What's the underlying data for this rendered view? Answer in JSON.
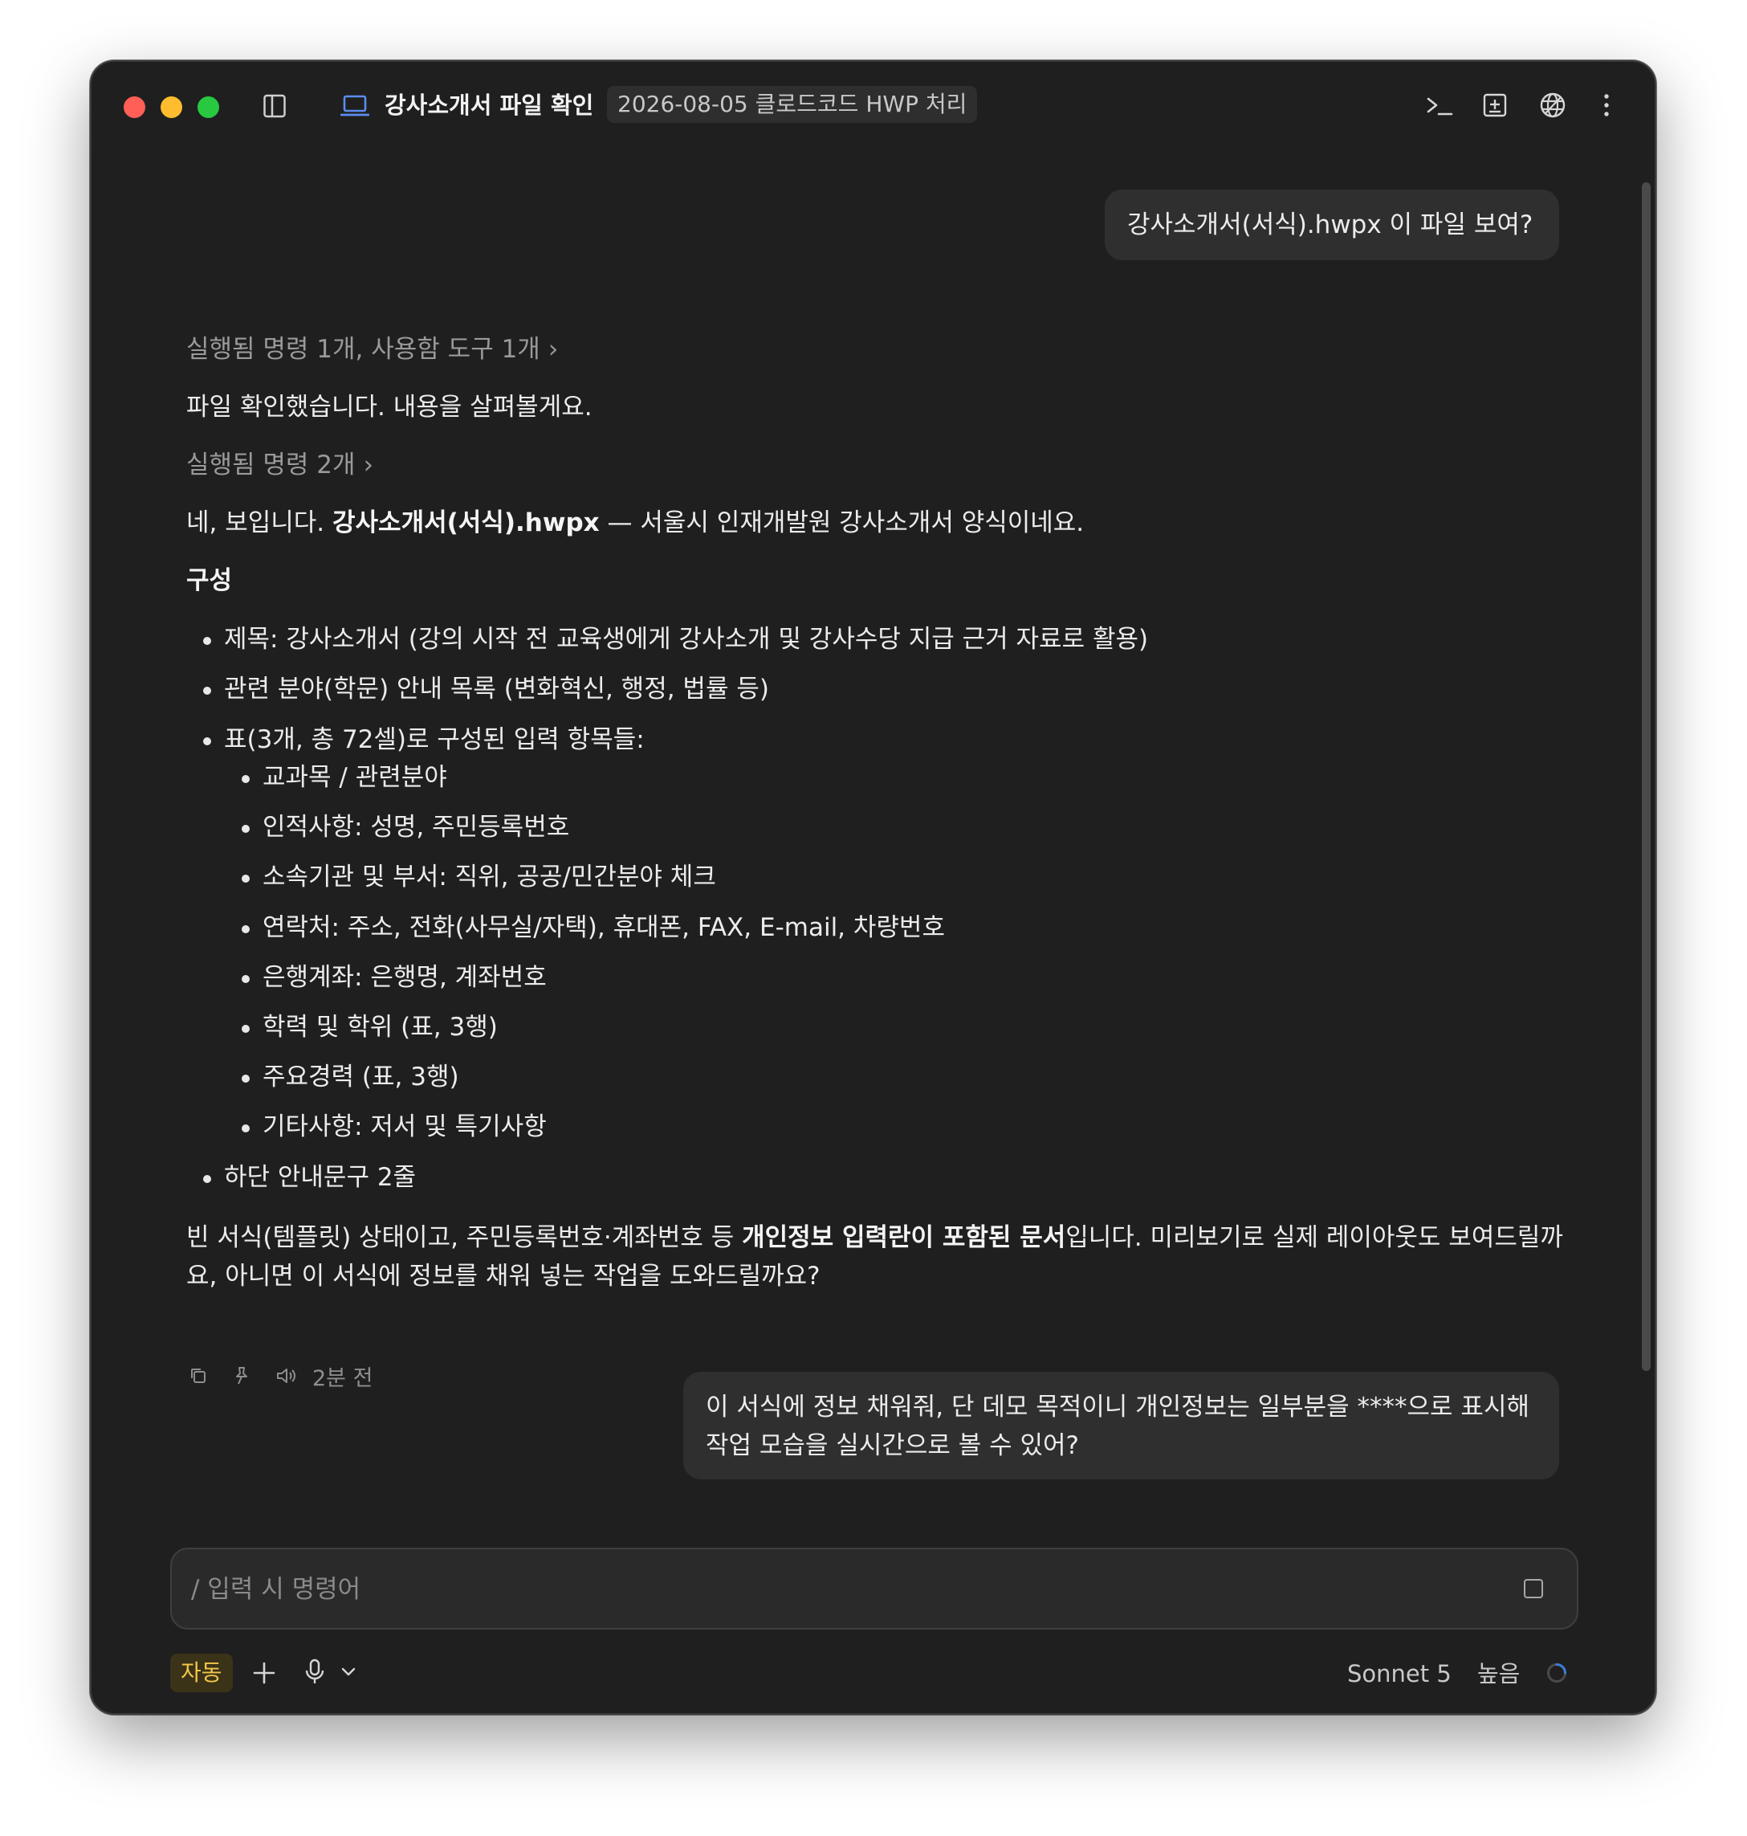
{
  "window": {
    "title": "강사소개서 파일 확인",
    "session_badge": "2026-08-05 클로드코드 HWP 처리"
  },
  "messages": {
    "user1": "강사소개서(서식).hwpx 이 파일 보여?",
    "assistant": {
      "tool_summary_1": "실행됨 명령 1개, 사용함 도구 1개",
      "text_1": "파일 확인했습니다. 내용을 살펴볼게요.",
      "tool_summary_2": "실행됨 명령 2개",
      "intro_prefix": "네, 보입니다. ",
      "intro_file": "강사소개서(서식).hwpx",
      "intro_suffix": " — 서울시 인재개발원 강사소개서 양식이네요.",
      "section_heading": "구성",
      "bullets": [
        "제목: 강사소개서 (강의 시작 전 교육생에게 강사소개 및 강사수당 지급 근거 자료로 활용)",
        "관련 분야(학문) 안내 목록 (변화혁신, 행정, 법률 등)",
        "표(3개, 총 72셀)로 구성된 입력 항목들:"
      ],
      "sub_bullets": [
        "교과목 / 관련분야",
        "인적사항: 성명, 주민등록번호",
        "소속기관 및 부서: 직위, 공공/민간분야 체크",
        "연락처: 주소, 전화(사무실/자택), 휴대폰, FAX, E-mail, 차량번호",
        "은행계좌: 은행명, 계좌번호",
        "학력 및 학위 (표, 3행)",
        "주요경력 (표, 3행)",
        "기타사항: 저서 및 특기사항"
      ],
      "last_bullet": "하단 안내문구 2줄",
      "closing_pre": "빈 서식(템플릿) 상태이고, 주민등록번호·계좌번호 등 ",
      "closing_bold": "개인정보 입력란이 포함된 문서",
      "closing_post": "입니다. 미리보기로 실제 레이아웃도 보여드릴까요, 아니면 이 서식에 정보를 채워 넣는 작업을 도와드릴까요?",
      "timestamp": "2분 전"
    },
    "user2": "이 서식에 정보 채워줘, 단 데모 목적이니 개인정보는 일부분을 ****으로 표시해 작업 모습을 실시간으로 볼 수 있어?"
  },
  "composer": {
    "placeholder": "/ 입력 시 명령어"
  },
  "footer": {
    "mode": "자동",
    "model": "Sonnet 5",
    "effort": "높음"
  },
  "colors": {
    "background": "#1f1f1f",
    "bubble": "#2f2f2f",
    "accent_auto": "#f3c64a",
    "laptop_icon": "#5b8def"
  }
}
